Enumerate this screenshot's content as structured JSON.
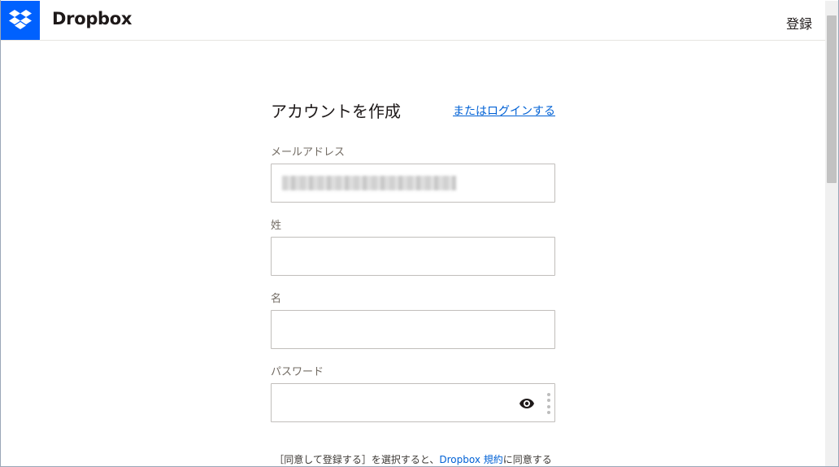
{
  "header": {
    "brand": "Dropbox",
    "signup": "登録",
    "brand_color": "#0061fe"
  },
  "form": {
    "title": "アカウントを作成",
    "login_link": "またはログインする",
    "email_label": "メールアドレス",
    "email_value_redacted": true,
    "last_name_label": "姓",
    "first_name_label": "名",
    "password_label": "パスワード"
  },
  "terms": {
    "prefix": "［同意して登録する］を選択すると、",
    "link": "Dropbox 規約",
    "suffix": "に同意する"
  },
  "icons": {
    "logo": "dropbox-logo-icon",
    "show_password": "eye-icon",
    "password_manager": "vertical-dots-icon"
  },
  "colors": {
    "link": "#0061d5",
    "input_border": "#c1bebb"
  }
}
